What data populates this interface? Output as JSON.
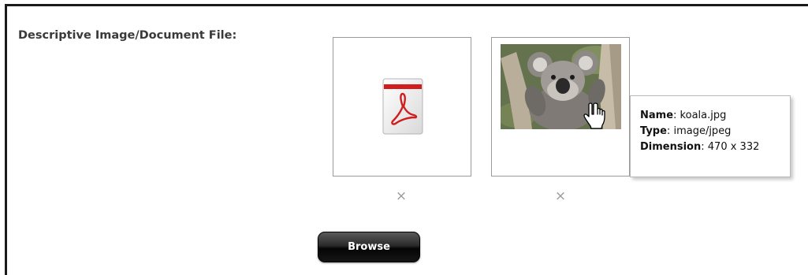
{
  "field": {
    "label": "Descriptive Image/Document File:"
  },
  "files": [
    {
      "icon": "pdf-file-icon",
      "remove_label": "×"
    },
    {
      "icon": "koala-image-thumbnail",
      "remove_label": "×"
    }
  ],
  "tooltip": {
    "name_label": "Name",
    "name_value": "koala.jpg",
    "type_label": "Type",
    "type_value": "image/jpeg",
    "dimension_label": "Dimension",
    "dimension_value": "470 x 332",
    "separator": ":"
  },
  "browse": {
    "label": "Browse"
  },
  "colors": {
    "frame": "#1a1a1a",
    "tile_border": "#9a9a9a",
    "remove_icon": "#9a9a9a",
    "pdf_red": "#d01e1e",
    "button_dark": "#050505"
  }
}
